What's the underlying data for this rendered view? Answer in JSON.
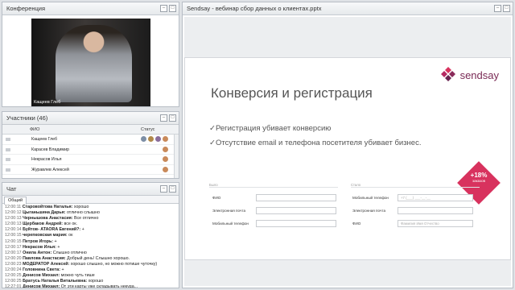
{
  "conference": {
    "title": "Конференция",
    "video_caption": "Кащеев Глеб"
  },
  "participants": {
    "title": "Участники (46)",
    "col_name": "ФИО",
    "col_status": "Статус",
    "rows": [
      {
        "name": "Кащеев Глеб"
      },
      {
        "name": "Карасев Владимир"
      },
      {
        "name": "Некрасов Илья"
      },
      {
        "name": "Журавлев Алексей"
      }
    ]
  },
  "chat": {
    "title": "Чат",
    "tab": "Общий",
    "lines": [
      {
        "time": "12:00:11",
        "name": "Старовойтова Наталья:",
        "text": " хорошо"
      },
      {
        "time": "12:00:12",
        "name": "Цыганьшина Дарья:",
        "text": " отлично слышно"
      },
      {
        "time": "12:00:13",
        "name": "Чернышова Анастасия:",
        "text": " Все отлично"
      },
      {
        "time": "12:00:13",
        "name": "Щербаков Андрей:",
        "text": " все ок."
      },
      {
        "time": "12:00:14",
        "name": "Буйтов- ATAORA Евгений?:",
        "text": " +"
      },
      {
        "time": "12:00:15",
        "name": "черепковская мария:",
        "text": " ок"
      },
      {
        "time": "12:00:15",
        "name": "Петров Игорь:",
        "text": " +"
      },
      {
        "time": "12:00:17",
        "name": "Некрасов Илья:",
        "text": " +"
      },
      {
        "time": "12:00:17",
        "name": "Онила Антон:",
        "text": " Слышно отлично"
      },
      {
        "time": "12:00:20",
        "name": "Павлова Анастасия:",
        "text": " Добрый день! Слышно хорошо."
      },
      {
        "time": "12:00:23",
        "name": "МОДЕРАТОР Алексей:",
        "text": " хорошо слышно, но можно потише чуточку)"
      },
      {
        "time": "12:00:24",
        "name": "Головнина Света:",
        "text": " +"
      },
      {
        "time": "12:00:25",
        "name": "Денисов Михаил:",
        "text": " можно чуть тише"
      },
      {
        "time": "12:00:25",
        "name": "Братусь Наталья Витальевна:",
        "text": " хорошо"
      },
      {
        "time": "12:27:01",
        "name": "Денисов Михаил:",
        "text": " От эти карты уже складывать некуда..."
      }
    ]
  },
  "presentation": {
    "title": "Sendsay - вебинар сбор данных о клиентах.pptx",
    "slide": {
      "logo": "sendsay",
      "heading": "Конверсия и регистрация",
      "bullets": [
        "✓Регистрация убивает конверсию",
        "✓Отсутствие email и телефона посетителя убивает бизнес."
      ],
      "badge_big": "+18%",
      "badge_small": "заказов",
      "form_left": {
        "caption": "Было",
        "fields": [
          "ФИО",
          "Электронная почта",
          "Мобильный телефон"
        ]
      },
      "form_right": {
        "caption": "Стало",
        "fields": [
          "Мобильный телефон",
          "Электронная почта",
          "ФИО"
        ],
        "phone_placeholder": "+7 (___) ___-__-__",
        "name_placeholder": "Фамилия Имя Отчество"
      }
    }
  },
  "colors": {
    "brand": "#d8325e",
    "logo_text": "#7a2a55"
  }
}
